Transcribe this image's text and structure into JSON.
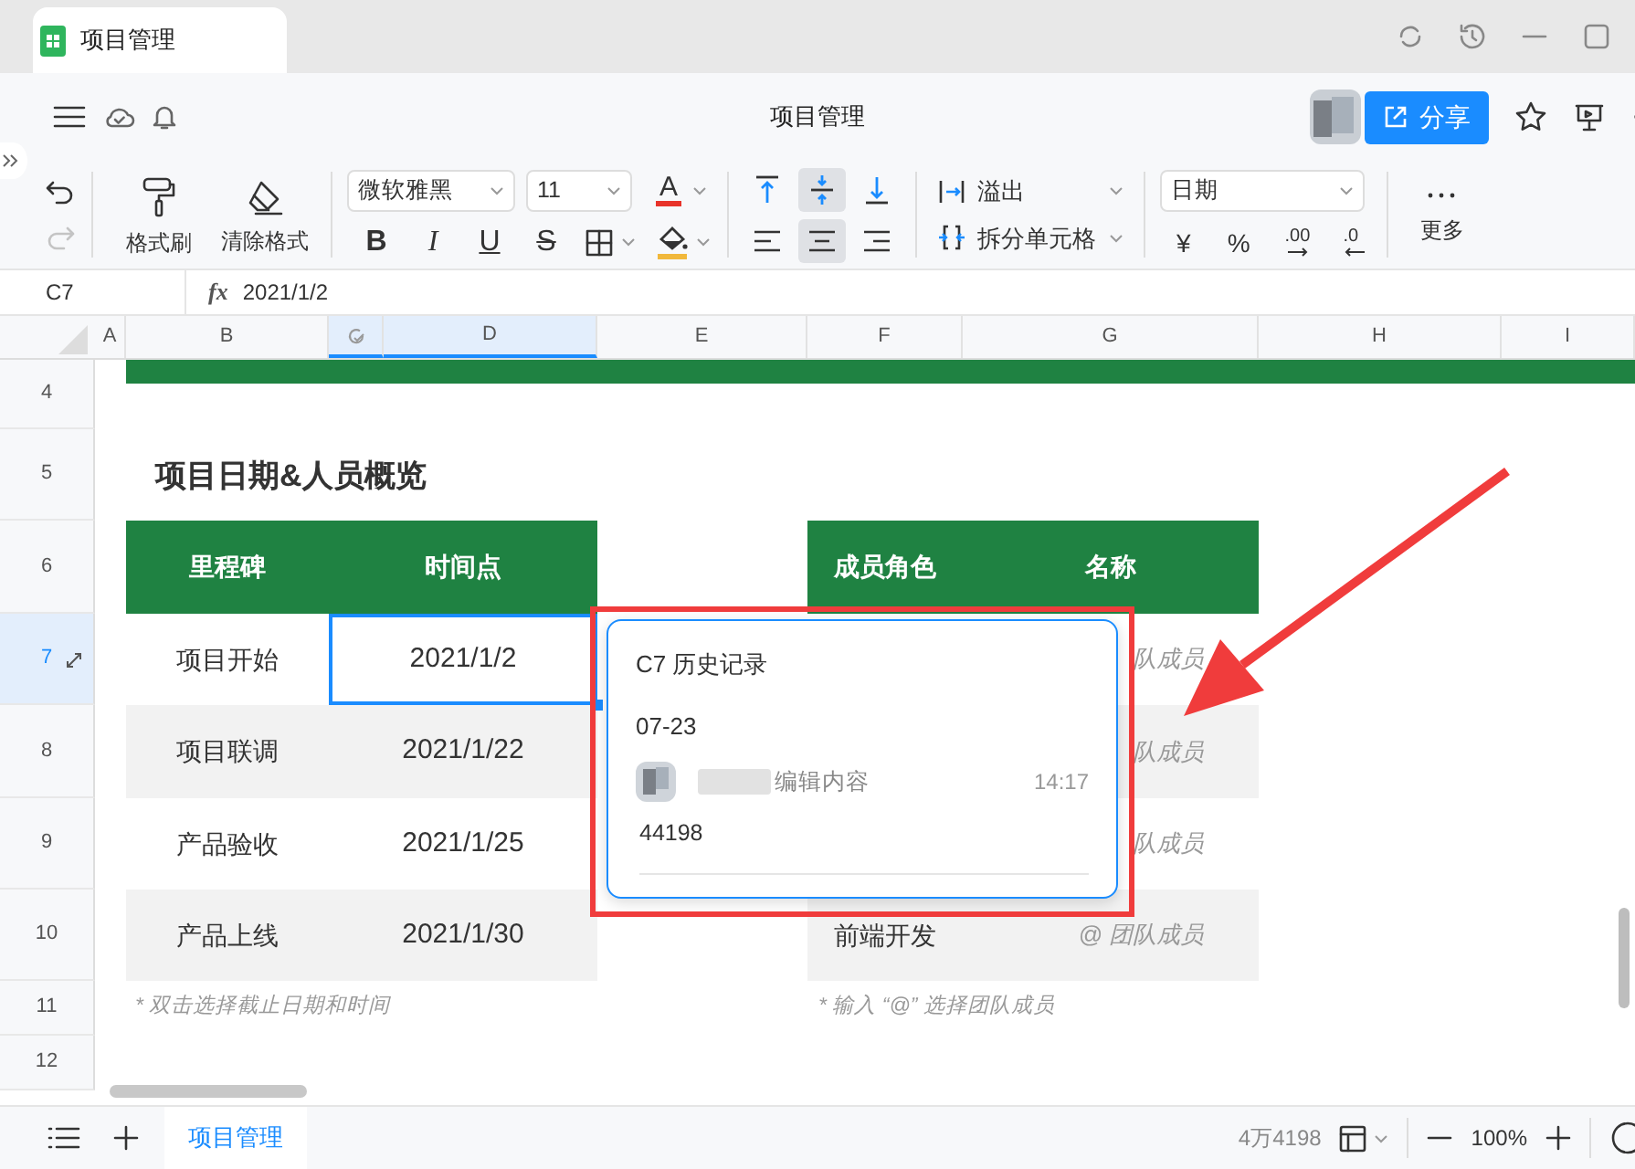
{
  "app_tab": {
    "title": "项目管理",
    "selected": true
  },
  "header": {
    "title": "项目管理",
    "share_label": "分享"
  },
  "toolbar": {
    "format_painter": "格式刷",
    "clear_format": "清除格式",
    "font": "微软雅黑",
    "size": "11",
    "font_color_glyph": "A",
    "styles": [
      "B",
      "I",
      "U",
      "S"
    ],
    "wrap": "溢出",
    "split": "拆分单元格",
    "number_format": "日期",
    "currency": "¥",
    "percent": "%",
    "add_decimal": ".00",
    "remove_decimal": ".0",
    "more": "更多",
    "redo_disabled": true,
    "valign": [
      {
        "kind": "top",
        "selected": false
      },
      {
        "kind": "middle",
        "selected": true
      },
      {
        "kind": "bottom",
        "selected": false
      }
    ],
    "halign": [
      {
        "kind": "left",
        "selected": false
      },
      {
        "kind": "center",
        "selected": true
      },
      {
        "kind": "right",
        "selected": false
      }
    ]
  },
  "formula_bar": {
    "cell": "C7",
    "fx": "fx",
    "value": "2021/1/2"
  },
  "columns": [
    {
      "label": "A",
      "selected": false
    },
    {
      "label": "B",
      "selected": false
    },
    {
      "kind": "icon",
      "selected": true
    },
    {
      "label": "D",
      "selected": true
    },
    {
      "label": "E",
      "selected": false
    },
    {
      "label": "F",
      "selected": false
    },
    {
      "label": "G",
      "selected": false
    },
    {
      "label": "H",
      "selected": false
    },
    {
      "label": "I",
      "selected": false
    }
  ],
  "rows": [
    {
      "label": "4",
      "selected": false
    },
    {
      "label": "5",
      "selected": false
    },
    {
      "label": "6",
      "selected": false
    },
    {
      "label": "7",
      "selected": true
    },
    {
      "label": "8",
      "selected": false
    },
    {
      "label": "9",
      "selected": false
    },
    {
      "label": "10",
      "selected": false
    },
    {
      "label": "11",
      "selected": false
    },
    {
      "label": "12",
      "selected": false
    }
  ],
  "section_title": "项目日期&人员概览",
  "milestones": {
    "columns": [
      "里程碑",
      "时间点"
    ],
    "rows": [
      {
        "name": "项目开始",
        "date": "2021/1/2",
        "selected": true
      },
      {
        "name": "项目联调",
        "date": "2021/1/22",
        "selected": false
      },
      {
        "name": "产品验收",
        "date": "2021/1/25",
        "selected": false
      },
      {
        "name": "产品上线",
        "date": "2021/1/30",
        "selected": false
      }
    ]
  },
  "members": {
    "columns": [
      "成员角色",
      "名称"
    ],
    "rows": [
      {
        "name": "队成员"
      },
      {
        "name": "队成员"
      },
      {
        "name": "队成员"
      },
      {
        "role": "前端开发",
        "name": "@ 团队成员"
      }
    ]
  },
  "notes": [
    "* 双击选择截止日期和时间",
    "* 输入 “@” 选择团队成员"
  ],
  "history": {
    "title": "C7 历史记录",
    "date": "07-23",
    "action": "编辑内容",
    "time": "14:17",
    "value": "44198"
  },
  "sheet_tabs": [
    {
      "label": "项目管理",
      "selected": true
    }
  ],
  "status": {
    "count": "4万4198",
    "zoom": "100%"
  }
}
